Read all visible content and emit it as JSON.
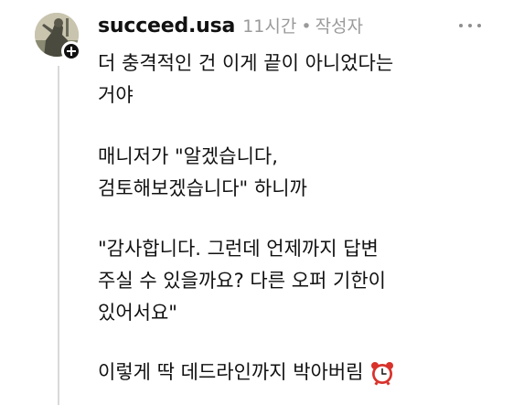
{
  "post": {
    "author": {
      "username": "succeed.usa",
      "avatar_icon": "statue-avatar-icon",
      "follow_icon": "plus-icon"
    },
    "timestamp": "11시간",
    "separator": "•",
    "author_tag": "작성자",
    "more_icon": "more-horizontal-icon",
    "paragraphs": [
      "더 충격적인 건 이게 끝이 아니었다는\n거야",
      "매니저가 \"알겠습니다,\n검토해보겠습니다\" 하니까",
      "\"감사합니다. 그런데 언제까지 답변\n주실 수 있을까요? 다른 오퍼 기한이\n있어서요\"",
      "이렇게 딱 데드라인까지 박아버림"
    ],
    "emoji_icon": "alarm-clock-icon",
    "colors": {
      "text": "#111111",
      "muted": "#9a9a9a",
      "thread_line": "#d9d9d9",
      "clock_red": "#d8322b"
    }
  }
}
